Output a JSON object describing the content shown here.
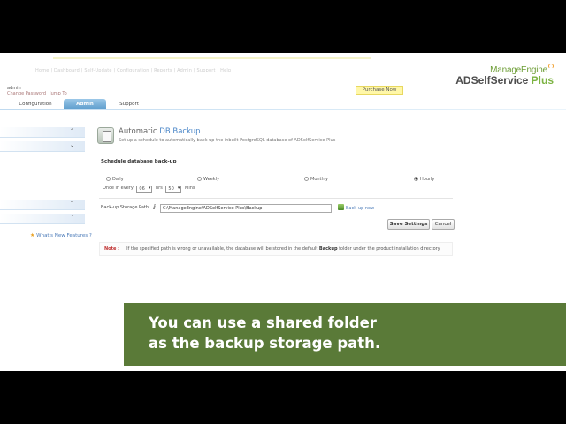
{
  "header": {
    "faint_links": "Home   |   Dashboard   |   Self-Update   |   Configuration   |   Reports   |   Admin   |   Support   |   Help",
    "logo_top": "ManageEngine",
    "logo_main": "ADSelfService",
    "logo_plus": "Plus",
    "user_name": "admin",
    "user_links": [
      "Change Password",
      "Jump To"
    ],
    "purchase_label": "Purchase Now"
  },
  "tabs": [
    {
      "label": "Configuration"
    },
    {
      "label": "Admin",
      "active": true
    },
    {
      "label": "Support"
    }
  ],
  "sidebar": {
    "whats_new_prefix": "What's New",
    "whats_new_suffix": "Features ?"
  },
  "panel": {
    "title_prefix": "Automatic",
    "title_accent": "DB Backup",
    "subtitle": "Set up a schedule to automatically back up the inbuilt PostgreSQL database of ADSelfService Plus",
    "schedule_label": "Schedule database back-up",
    "frequency_options": [
      "Daily",
      "Weekly",
      "Monthly",
      "Hourly"
    ],
    "selected_frequency": "Hourly",
    "once_in_every": "Once in every",
    "hours_value": "06",
    "hrs_label": "hrs",
    "mins_value": "50",
    "mins_label": "Mins",
    "path_label": "Back-up Storage Path",
    "path_value": "C:\\ManageEngine\\ADSelfService Plus\\Backup",
    "backup_now": "Back-up now",
    "save_label": "Save Settings",
    "cancel_label": "Cancel",
    "note_label": "Note :",
    "note_text_1": "If the specified path is wrong or unavailable, the database will be stored in the default ",
    "note_bold": "Backup",
    "note_text_2": " folder under the product installation directory"
  },
  "caption": {
    "line1": "You can use a shared folder",
    "line2": "as the backup storage path."
  },
  "colors": {
    "caption_bg": "#5a7a38",
    "accent_blue": "#4a86c8",
    "brand_green": "#7cb342"
  }
}
